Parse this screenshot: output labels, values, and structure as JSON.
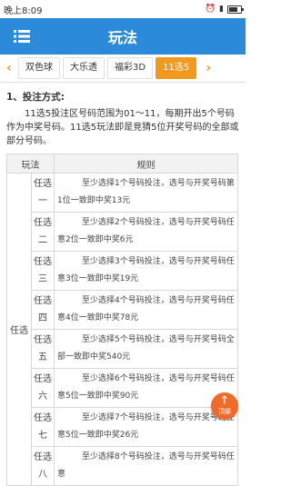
{
  "status": {
    "time": "晚上8:09"
  },
  "header": {
    "title": "玩法"
  },
  "tabs": [
    {
      "label": "双色球"
    },
    {
      "label": "大乐透"
    },
    {
      "label": "福彩3D"
    },
    {
      "label": "11选5"
    }
  ],
  "section": {
    "title": "1、投注方式:",
    "text": "11选5投注区号码范围为01～11，每期开出5个号码作为中奖号码。11选5玩法即是竞猜5位开奖号码的全部或部分号码。"
  },
  "table": {
    "headers": [
      "玩法",
      "规则"
    ],
    "group": "任选",
    "rows": [
      {
        "type": "任选一",
        "rule": "至少选择1个号码投注，选号与开奖号码第1位一致即中奖13元"
      },
      {
        "type": "任选二",
        "rule": "至少选择2个号码投注，选号与开奖号码任意2位一致即中奖6元"
      },
      {
        "type": "任选三",
        "rule": "至少选择3个号码投注，选号与开奖号码任意3位一致即中奖19元"
      },
      {
        "type": "任选四",
        "rule": "至少选择4个号码投注，选号与开奖号码任意4位一致即中奖78元"
      },
      {
        "type": "任选五",
        "rule": "至少选择5个号码投注，选号与开奖号码全部一致即中奖540元"
      },
      {
        "type": "任选六",
        "rule": "至少选择6个号码投注，选号与开奖号码任意5位一致即中奖90元"
      },
      {
        "type": "任选七",
        "rule": "至少选择7个号码投注，选号与开奖号码任意5位一致即中奖26元"
      },
      {
        "type": "任选八",
        "rule": "至少选择8个号码投注，选号与开奖号码任意"
      }
    ]
  },
  "top_button": {
    "label": "顶部"
  },
  "colors": {
    "primary": "#2b8ad9",
    "accent": "#f39a1e",
    "top_button": "#f06b2a"
  }
}
